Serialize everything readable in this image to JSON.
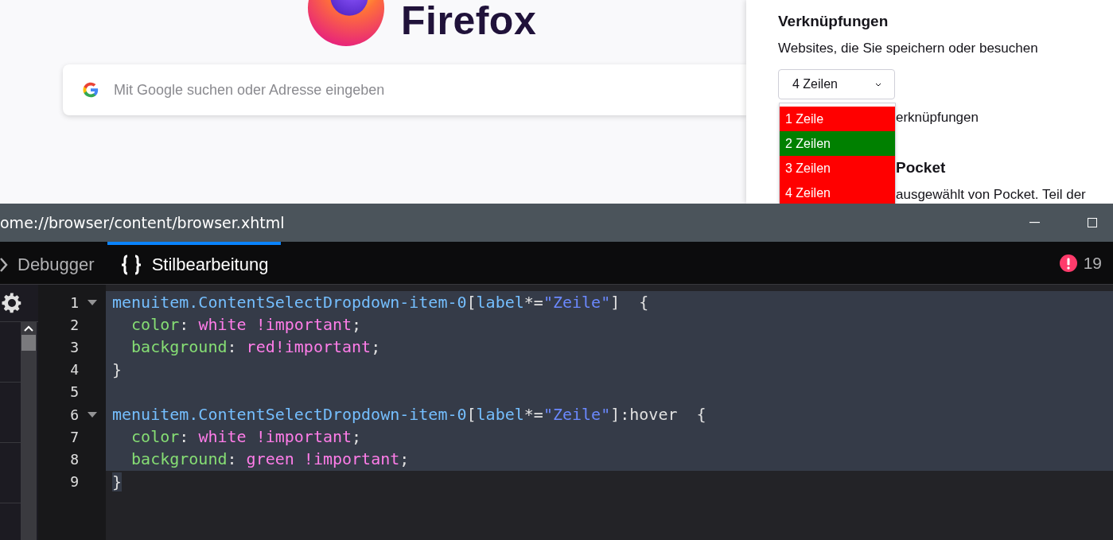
{
  "newtab": {
    "brand": "Firefox",
    "search": {
      "placeholder": "Mit Google suchen oder Adresse eingeben"
    }
  },
  "settings_panel": {
    "title": "Verknüpfungen",
    "subtitle": "Websites, die Sie speichern oder besuchen",
    "select": {
      "value": "4 Zeilen",
      "expanded": true
    },
    "options": [
      {
        "label": "1 Zeile",
        "color": "#ff0000"
      },
      {
        "label": "2 Zeilen",
        "color": "#008000"
      },
      {
        "label": "3 Zeilen",
        "color": "#ff0000"
      },
      {
        "label": "4 Zeilen",
        "color": "#ff0000"
      }
    ],
    "partial_texts": [
      {
        "text": "erknüpfungen",
        "kind": "label"
      },
      {
        "text": "Pocket",
        "kind": "heading"
      },
      {
        "text": "ausgewählt von Pocket. Teil der",
        "kind": "label"
      }
    ]
  },
  "devtools": {
    "title": "ome://browser/content/browser.xhtml",
    "tabs": [
      {
        "label": "Debugger",
        "selected": false
      },
      {
        "label": "Stilbearbeitung",
        "selected": true
      }
    ],
    "error_count": "19",
    "code_lines": [
      {
        "number": "1",
        "foldable": true,
        "selected": true,
        "tokens": [
          {
            "text": "menuitem.ContentSelectDropdown-item-0",
            "kind": "selector"
          },
          {
            "text": "[",
            "kind": "punct"
          },
          {
            "text": "label",
            "kind": "attr"
          },
          {
            "text": "*=",
            "kind": "punct"
          },
          {
            "text": "\"Zeile\"",
            "kind": "string"
          },
          {
            "text": "]  {",
            "kind": "punct"
          }
        ]
      },
      {
        "number": "2",
        "foldable": false,
        "selected": true,
        "tokens": [
          {
            "text": "  color",
            "kind": "property"
          },
          {
            "text": ": ",
            "kind": "punct"
          },
          {
            "text": "white !important",
            "kind": "value"
          },
          {
            "text": ";",
            "kind": "punct"
          }
        ]
      },
      {
        "number": "3",
        "foldable": false,
        "selected": true,
        "tokens": [
          {
            "text": "  background",
            "kind": "property"
          },
          {
            "text": ": ",
            "kind": "punct"
          },
          {
            "text": "red!important",
            "kind": "value"
          },
          {
            "text": ";",
            "kind": "punct"
          }
        ]
      },
      {
        "number": "4",
        "foldable": false,
        "selected": true,
        "tokens": [
          {
            "text": "}",
            "kind": "punct"
          }
        ]
      },
      {
        "number": "5",
        "foldable": false,
        "selected": true
      },
      {
        "number": "6",
        "foldable": true,
        "selected": true,
        "tokens": [
          {
            "text": "menuitem.ContentSelectDropdown-item-0",
            "kind": "selector"
          },
          {
            "text": "[",
            "kind": "punct"
          },
          {
            "text": "label",
            "kind": "attr"
          },
          {
            "text": "*=",
            "kind": "punct"
          },
          {
            "text": "\"Zeile\"",
            "kind": "string"
          },
          {
            "text": "]:hover  {",
            "kind": "punct"
          }
        ]
      },
      {
        "number": "7",
        "foldable": false,
        "selected": true,
        "tokens": [
          {
            "text": "  color",
            "kind": "property"
          },
          {
            "text": ": ",
            "kind": "punct"
          },
          {
            "text": "white !important",
            "kind": "value"
          },
          {
            "text": ";",
            "kind": "punct"
          }
        ]
      },
      {
        "number": "8",
        "foldable": false,
        "selected": true,
        "tokens": [
          {
            "text": "  background",
            "kind": "property"
          },
          {
            "text": ": ",
            "kind": "punct"
          },
          {
            "text": "green !important",
            "kind": "value"
          },
          {
            "text": ";",
            "kind": "punct"
          }
        ]
      },
      {
        "number": "9",
        "foldable": false,
        "selected": true,
        "tokens": [
          {
            "text": "}",
            "kind": "punct"
          }
        ]
      }
    ]
  }
}
